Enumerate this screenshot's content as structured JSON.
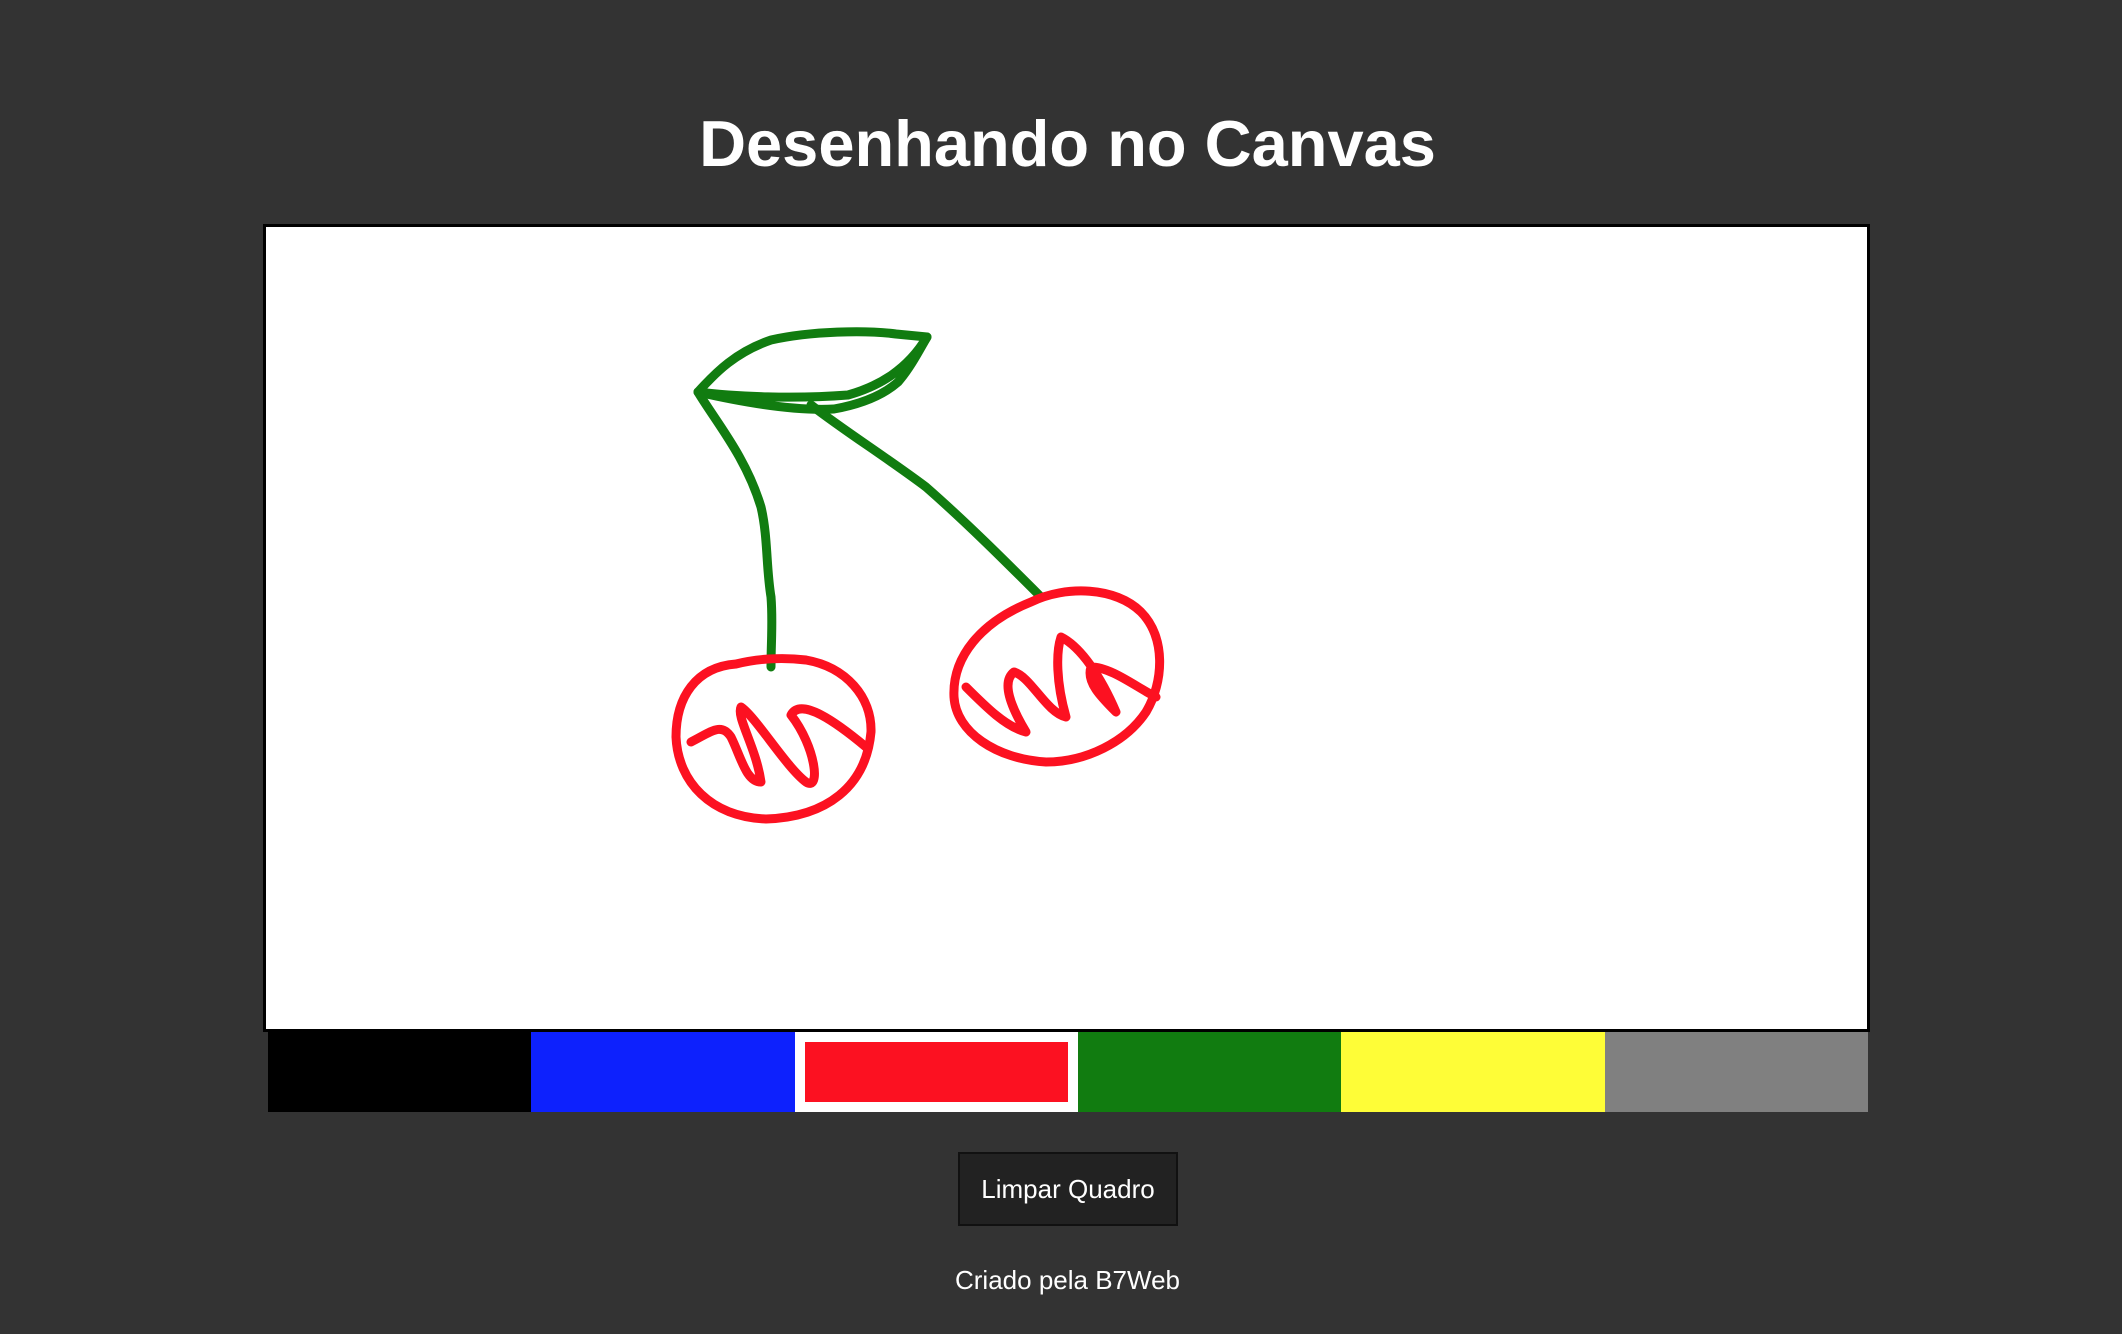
{
  "header": {
    "title": "Desenhando no Canvas"
  },
  "canvas": {
    "strokes": [
      {
        "color": "#117c10",
        "label": "leaf and stems"
      },
      {
        "color": "#fc1121",
        "label": "left cherry"
      },
      {
        "color": "#fc1121",
        "label": "right cherry"
      }
    ]
  },
  "palette": {
    "colors": [
      {
        "name": "black",
        "hex": "#000000"
      },
      {
        "name": "blue",
        "hex": "#0d21fd"
      },
      {
        "name": "red",
        "hex": "#fc1121"
      },
      {
        "name": "green",
        "hex": "#117c10"
      },
      {
        "name": "yellow",
        "hex": "#fefd37"
      },
      {
        "name": "gray",
        "hex": "#808080"
      }
    ],
    "selected": "red"
  },
  "actions": {
    "clear_label": "Limpar Quadro"
  },
  "footer": {
    "credit": "Criado pela B7Web"
  }
}
